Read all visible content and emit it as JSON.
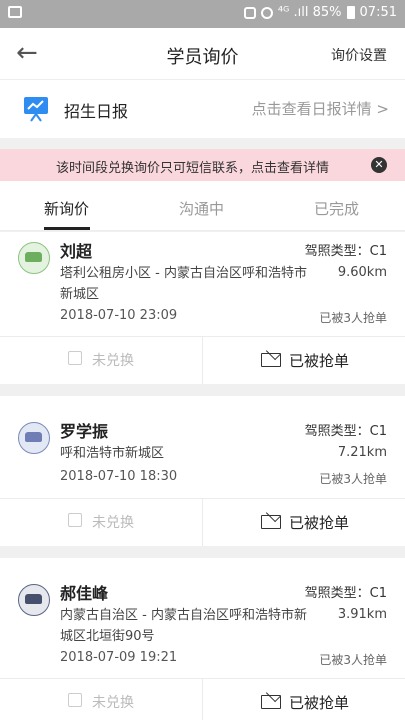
{
  "status": {
    "right_text": "⁴ᴳ .ıll 85%",
    "time": "07:51"
  },
  "nav": {
    "title": "学员询价",
    "right": "询价设置"
  },
  "report": {
    "label": "招生日报",
    "link": "点击查看日报详情 >"
  },
  "notice": {
    "text": "该时间段兑换询价只可短信联系，点击查看详情"
  },
  "tabs": [
    {
      "label": "新询价"
    },
    {
      "label": "沟通中"
    },
    {
      "label": "已完成"
    }
  ],
  "cards": [
    {
      "name": "刘超",
      "license": "驾照类型：C1",
      "address": "塔利公租房小区 - 内蒙古自治区呼和浩特市新城区",
      "distance": "9.60km",
      "time": "2018-07-10 23:09",
      "grabbed": "已被3人抢单",
      "left_action": "未兑换",
      "right_action": "已被抢单"
    },
    {
      "name": "罗学振",
      "license": "驾照类型：C1",
      "address": "呼和浩特市新城区",
      "distance": "7.21km",
      "time": "2018-07-10 18:30",
      "grabbed": "已被3人抢单",
      "left_action": "未兑换",
      "right_action": "已被抢单"
    },
    {
      "name": "郝佳峰",
      "license": "驾照类型：C1",
      "address": "内蒙古自治区 - 内蒙古自治区呼和浩特市新城区北垣街90号",
      "distance": "3.91km",
      "time": "2018-07-09 19:21",
      "grabbed": "已被3人抢单",
      "left_action": "未兑换",
      "right_action": "已被抢单"
    }
  ],
  "colors": {
    "notice_bg": "#f9d7dd",
    "accent": "#222222"
  }
}
